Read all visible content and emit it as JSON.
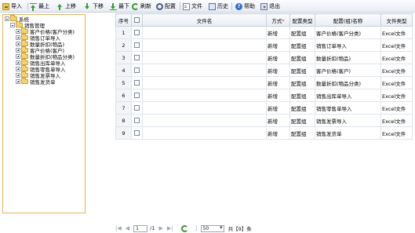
{
  "toolbar": {
    "buttons": [
      {
        "label": "导入",
        "icon": "import-icon"
      },
      {
        "label": "最上",
        "icon": "move-top-icon"
      },
      {
        "label": "上移",
        "icon": "move-up-icon"
      },
      {
        "label": "下移",
        "icon": "move-down-icon"
      },
      {
        "label": "最下",
        "icon": "move-bottom-icon"
      },
      {
        "label": "刷新",
        "icon": "refresh-icon"
      },
      {
        "label": "配置",
        "icon": "config-icon"
      },
      {
        "label": "文件",
        "icon": "file-icon"
      },
      {
        "label": "历史",
        "icon": "history-icon"
      },
      {
        "label": "帮助",
        "icon": "help-icon"
      },
      {
        "label": "退出",
        "icon": "exit-icon"
      }
    ]
  },
  "tree": {
    "root": "系统",
    "group": "销售管理",
    "items": [
      "客户价格(客户分类)",
      "销售订单导入",
      "数量折扣(物品)",
      "客户价格(客户)",
      "数量折扣(物品分类)",
      "销售出库单导入",
      "销售零售单导入",
      "销售发票导入",
      "销售发货单"
    ]
  },
  "grid": {
    "columns": {
      "index": "序号",
      "filename": "文件名",
      "mode": "方式",
      "mode_required_mark": "*",
      "config_type": "配置类型",
      "config_name": "配置(组)名称",
      "file_type": "文件类型"
    },
    "rows": [
      {
        "index": "1",
        "filename": "",
        "mode": "新增",
        "config_type": "配置组",
        "config_name": "客户价格(客户分类)",
        "file_type": "Excel文件"
      },
      {
        "index": "2",
        "filename": "",
        "mode": "新增",
        "config_type": "配置组",
        "config_name": "销售订单导入",
        "file_type": "Excel文件"
      },
      {
        "index": "3",
        "filename": "",
        "mode": "新增",
        "config_type": "配置组",
        "config_name": "数量折扣(物品)",
        "file_type": "Excel文件"
      },
      {
        "index": "4",
        "filename": "",
        "mode": "新增",
        "config_type": "配置组",
        "config_name": "客户价格(客户)",
        "file_type": "Excel文件"
      },
      {
        "index": "5",
        "filename": "",
        "mode": "新增",
        "config_type": "配置组",
        "config_name": "数量折扣(物品分类)",
        "file_type": "Excel文件"
      },
      {
        "index": "6",
        "filename": "",
        "mode": "新增",
        "config_type": "配置组",
        "config_name": "销售出库单导入",
        "file_type": "Excel文件"
      },
      {
        "index": "7",
        "filename": "",
        "mode": "新增",
        "config_type": "配置组",
        "config_name": "销售零售单导入",
        "file_type": "Excel文件"
      },
      {
        "index": "8",
        "filename": "",
        "mode": "新增",
        "config_type": "配置组",
        "config_name": "销售发票导入",
        "file_type": "Excel文件"
      },
      {
        "index": "9",
        "filename": "",
        "mode": "新增",
        "config_type": "配置组",
        "config_name": "销售发货单",
        "file_type": "Excel文件"
      }
    ]
  },
  "pager": {
    "page_input": "1",
    "page_total": "/1",
    "page_size": "50",
    "summary": "共【9】条"
  }
}
